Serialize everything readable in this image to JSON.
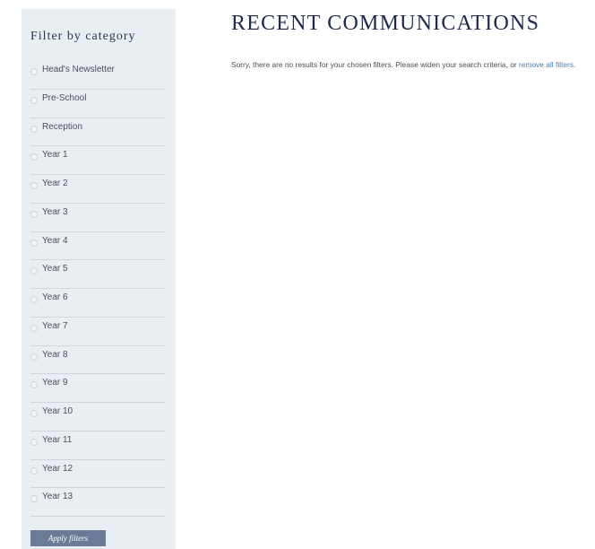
{
  "sidebar": {
    "title": "Filter by category",
    "categories": [
      "Head's Newsletter",
      "Pre-School",
      "Reception",
      "Year 1",
      "Year 2",
      "Year 3",
      "Year 4",
      "Year 5",
      "Year 6",
      "Year 7",
      "Year 8",
      "Year 9",
      "Year 10",
      "Year 11",
      "Year 12",
      "Year 13"
    ],
    "apply_button_label": "Apply filters"
  },
  "main": {
    "title": "RECENT COMMUNICATIONS",
    "message_text": "Sorry, there are no results for your chosen filters. Please widen your search criteria, or",
    "remove_filters_link": "remove all filters",
    "message_end": "."
  },
  "colors": {
    "sidebar_background": "#e8eef2",
    "title_color": "#1f2a4a",
    "link_color": "#4a7fb0",
    "button_background": "#6b7a96"
  }
}
